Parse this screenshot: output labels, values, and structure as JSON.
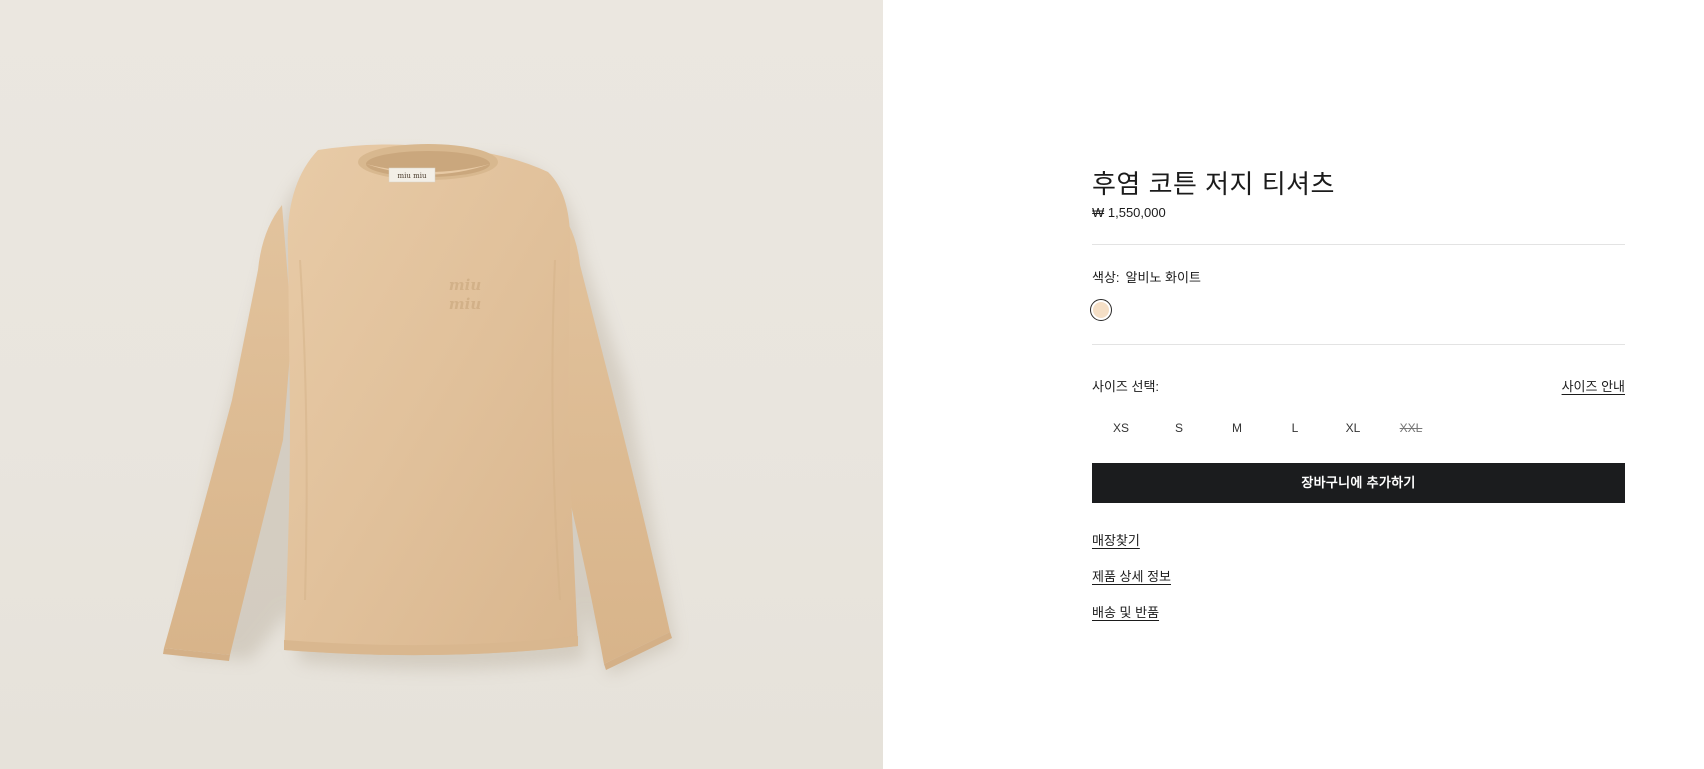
{
  "product": {
    "title": "후염 코튼 저지 티셔츠",
    "price": "₩ 1,550,000",
    "image_alt": "miu miu"
  },
  "color": {
    "label": "색상:",
    "value": "알비노 화이트",
    "swatch_color": "#f5dfc6"
  },
  "size": {
    "label": "사이즈 선택:",
    "guide_label": "사이즈 안내",
    "options": [
      {
        "label": "XS",
        "available": true
      },
      {
        "label": "S",
        "available": true
      },
      {
        "label": "M",
        "available": true
      },
      {
        "label": "L",
        "available": true
      },
      {
        "label": "XL",
        "available": true
      },
      {
        "label": "XXL",
        "available": false
      }
    ]
  },
  "actions": {
    "add_to_cart": "장바구니에 추가하기"
  },
  "links": {
    "store_locator": "매장찾기",
    "product_details": "제품 상세 정보",
    "shipping_returns": "배송 및 반품"
  },
  "colors": {
    "background_left": "#ebe7e0",
    "tshirt": "#e3c49f",
    "button": "#1b1c1e"
  }
}
